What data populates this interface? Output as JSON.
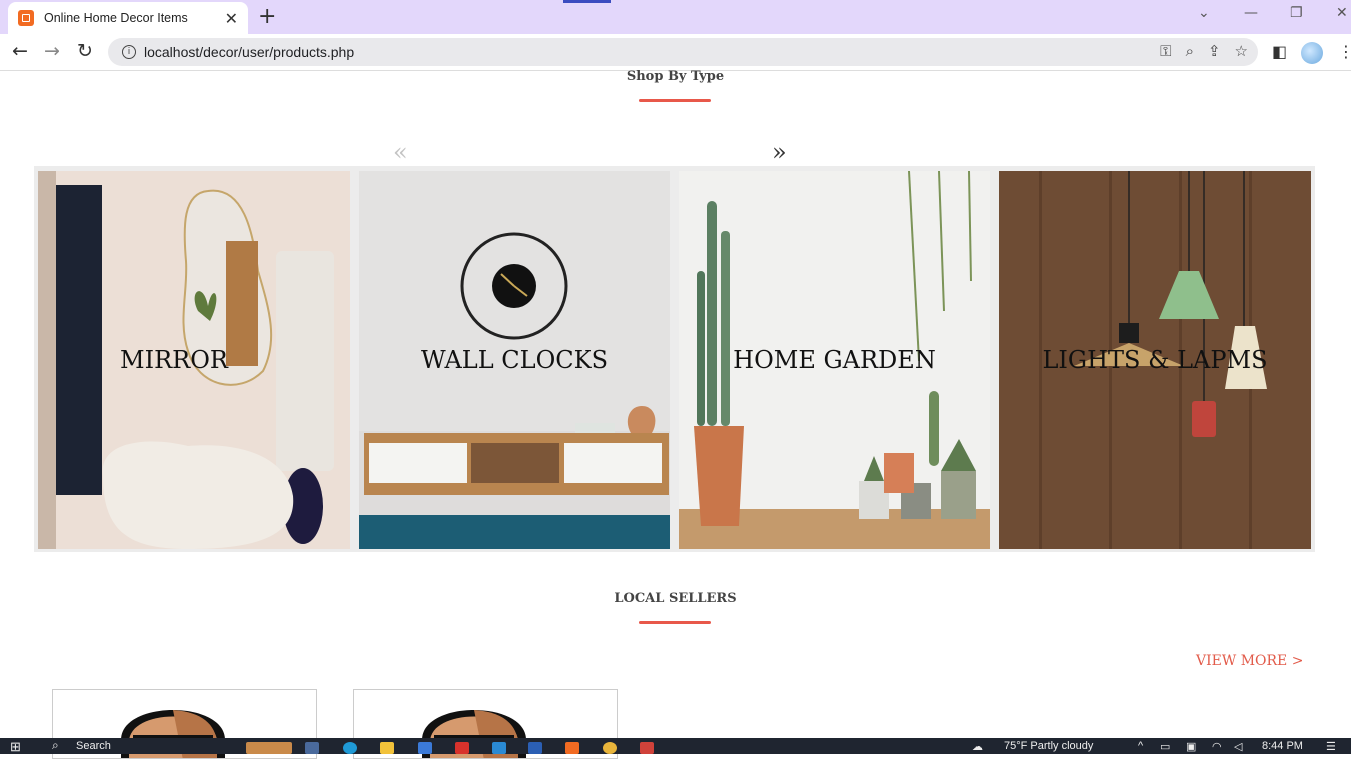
{
  "browser": {
    "tab_title": "Online Home Decor Items",
    "url": "localhost/decor/user/products.php"
  },
  "shop_by_type": {
    "heading": "Shop By Type",
    "prev_arrow": "«",
    "next_arrow": "»",
    "categories": [
      {
        "label": "MIRROR"
      },
      {
        "label": "WALL CLOCKS"
      },
      {
        "label": "HOME GARDEN"
      },
      {
        "label": "LIGHTS & LAPMS"
      }
    ]
  },
  "local_sellers": {
    "heading": "LOCAL SELLERS",
    "view_more": "VIEW MORE >"
  },
  "taskbar": {
    "search": "Search",
    "weather": "75°F  Partly cloudy",
    "time": "8:44 PM"
  },
  "colors": {
    "accent": "#e8584a",
    "tabbar": "#e3d7fb"
  }
}
